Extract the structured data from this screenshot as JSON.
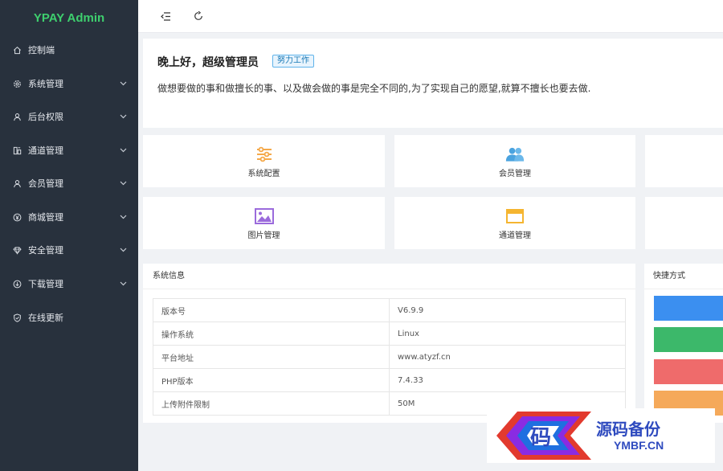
{
  "app": {
    "title": "YPAY Admin"
  },
  "sidebar": {
    "items": [
      {
        "label": "控制端",
        "icon": "home-icon",
        "expandable": false
      },
      {
        "label": "系统管理",
        "icon": "gear-icon",
        "expandable": true
      },
      {
        "label": "后台权限",
        "icon": "user-icon",
        "expandable": true
      },
      {
        "label": "通道管理",
        "icon": "channel-icon",
        "expandable": true
      },
      {
        "label": "会员管理",
        "icon": "user-icon",
        "expandable": true
      },
      {
        "label": "商城管理",
        "icon": "yen-icon",
        "expandable": true
      },
      {
        "label": "安全管理",
        "icon": "diamond-icon",
        "expandable": true
      },
      {
        "label": "下载管理",
        "icon": "download-icon",
        "expandable": true
      },
      {
        "label": "在线更新",
        "icon": "shield-icon",
        "expandable": false
      }
    ]
  },
  "header": {
    "menu_toggle_icon": "menu-fold-icon",
    "refresh_icon": "refresh-icon"
  },
  "welcome": {
    "greeting": "晚上好，超级管理员",
    "badge": "努力工作",
    "motto": "做想要做的事和做擅长的事、以及做会做的事是完全不同的,为了实现自己的愿望,就算不擅长也要去做."
  },
  "cards": [
    {
      "label": "系统配置",
      "icon": "sliders-icon",
      "color": "#f5a94a"
    },
    {
      "label": "会员管理",
      "icon": "users-icon",
      "color": "#4aa3df"
    },
    {
      "label": "图片管理",
      "icon": "image-icon",
      "color": "#9b6bdc"
    },
    {
      "label": "通道管理",
      "icon": "window-icon",
      "color": "#f5b530"
    }
  ],
  "sysinfo": {
    "title": "系统信息",
    "rows": [
      {
        "key": "版本号",
        "value": "V6.9.9"
      },
      {
        "key": "操作系统",
        "value": "Linux"
      },
      {
        "key": "平台地址",
        "value": "www.atyzf.cn"
      },
      {
        "key": "PHP版本",
        "value": "7.4.33"
      },
      {
        "key": "上传附件限制",
        "value": "50M"
      }
    ]
  },
  "shortcuts": {
    "title": "快捷方式",
    "colors": [
      "#3b8ff0",
      "#3cb86a",
      "#ef6b6b",
      "#f5a95a"
    ]
  },
  "watermark": {
    "char": "码",
    "title": "源码备份",
    "subtitle": "YMBF.CN"
  },
  "colors": {
    "sidebar": "#28313d",
    "logo": "#3ecf6e",
    "accent": "#1677b5"
  }
}
